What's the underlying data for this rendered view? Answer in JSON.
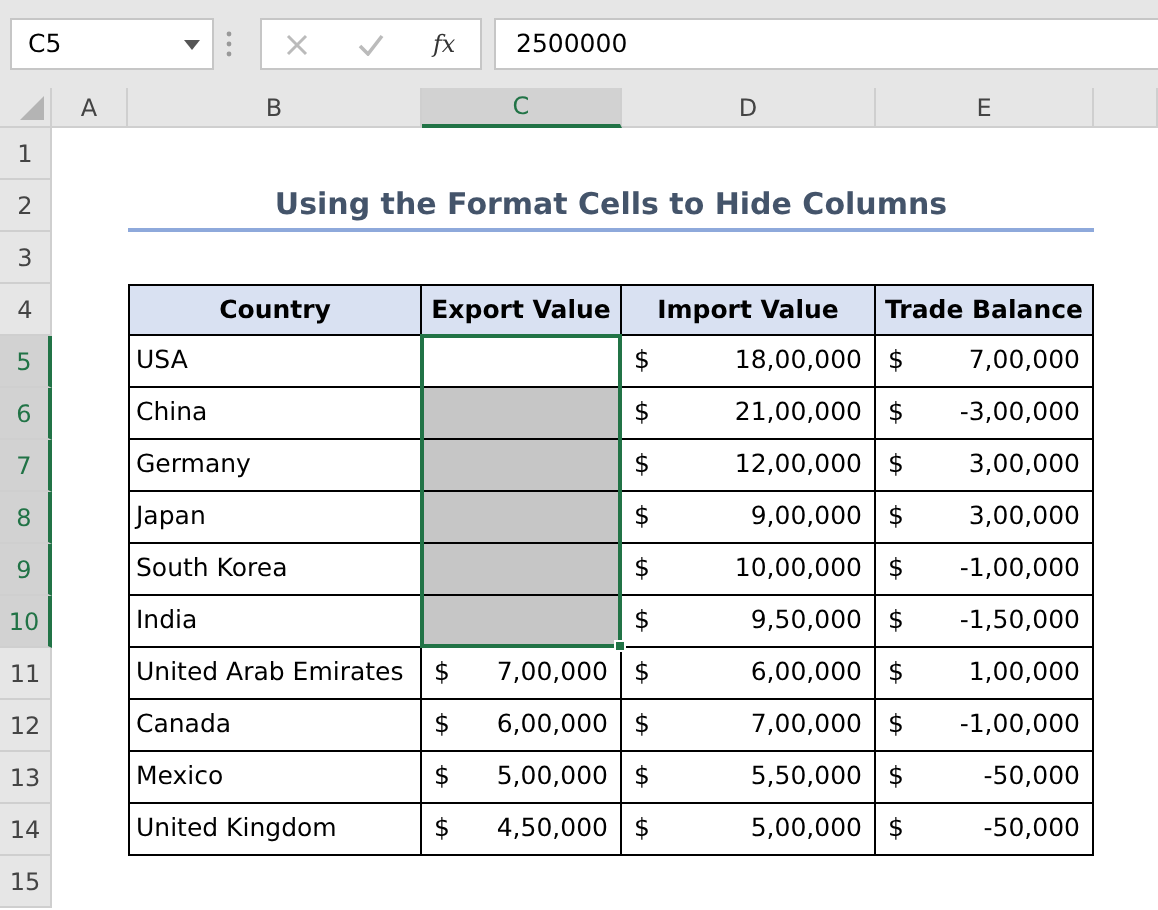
{
  "name_box": {
    "value": "C5"
  },
  "formula_bar": {
    "function_label": "fx",
    "value": "2500000",
    "cancel_disabled": true,
    "enter_disabled": true
  },
  "columns": [
    {
      "label": "A",
      "selected": false
    },
    {
      "label": "B",
      "selected": false
    },
    {
      "label": "C",
      "selected": true
    },
    {
      "label": "D",
      "selected": false
    },
    {
      "label": "E",
      "selected": false
    }
  ],
  "rows": [
    {
      "label": "1",
      "selected": false
    },
    {
      "label": "2",
      "selected": false
    },
    {
      "label": "3",
      "selected": false
    },
    {
      "label": "4",
      "selected": false
    },
    {
      "label": "5",
      "selected": true
    },
    {
      "label": "6",
      "selected": true
    },
    {
      "label": "7",
      "selected": true
    },
    {
      "label": "8",
      "selected": true
    },
    {
      "label": "9",
      "selected": true
    },
    {
      "label": "10",
      "selected": true
    },
    {
      "label": "11",
      "selected": false
    },
    {
      "label": "12",
      "selected": false
    },
    {
      "label": "13",
      "selected": false
    },
    {
      "label": "14",
      "selected": false
    },
    {
      "label": "15",
      "selected": false
    }
  ],
  "title": "Using the Format Cells to Hide Columns",
  "table": {
    "columns": [
      "Country",
      "Export Value",
      "Import Value",
      "Trade Balance"
    ],
    "rows": [
      {
        "country": "USA",
        "export": {
          "selected": true,
          "active": true
        },
        "import": {
          "currency": "$",
          "amount": "18,00,000"
        },
        "balance": {
          "currency": "$",
          "amount": "7,00,000"
        }
      },
      {
        "country": "China",
        "export": {
          "selected": true,
          "active": false
        },
        "import": {
          "currency": "$",
          "amount": "21,00,000"
        },
        "balance": {
          "currency": "$",
          "amount": "-3,00,000"
        }
      },
      {
        "country": "Germany",
        "export": {
          "selected": true,
          "active": false
        },
        "import": {
          "currency": "$",
          "amount": "12,00,000"
        },
        "balance": {
          "currency": "$",
          "amount": "3,00,000"
        }
      },
      {
        "country": "Japan",
        "export": {
          "selected": true,
          "active": false
        },
        "import": {
          "currency": "$",
          "amount": "9,00,000"
        },
        "balance": {
          "currency": "$",
          "amount": "3,00,000"
        }
      },
      {
        "country": "South Korea",
        "export": {
          "selected": true,
          "active": false
        },
        "import": {
          "currency": "$",
          "amount": "10,00,000"
        },
        "balance": {
          "currency": "$",
          "amount": "-1,00,000"
        }
      },
      {
        "country": "India",
        "export": {
          "selected": true,
          "active": false
        },
        "import": {
          "currency": "$",
          "amount": "9,50,000"
        },
        "balance": {
          "currency": "$",
          "amount": "-1,50,000"
        }
      },
      {
        "country": "United Arab Emirates",
        "export": {
          "currency": "$",
          "amount": "7,00,000",
          "selected": false
        },
        "import": {
          "currency": "$",
          "amount": "6,00,000"
        },
        "balance": {
          "currency": "$",
          "amount": "1,00,000"
        }
      },
      {
        "country": "Canada",
        "export": {
          "currency": "$",
          "amount": "6,00,000",
          "selected": false
        },
        "import": {
          "currency": "$",
          "amount": "7,00,000"
        },
        "balance": {
          "currency": "$",
          "amount": "-1,00,000"
        }
      },
      {
        "country": "Mexico",
        "export": {
          "currency": "$",
          "amount": "5,00,000",
          "selected": false
        },
        "import": {
          "currency": "$",
          "amount": "5,50,000"
        },
        "balance": {
          "currency": "$",
          "amount": "-50,000"
        }
      },
      {
        "country": "United Kingdom",
        "export": {
          "currency": "$",
          "amount": "4,50,000",
          "selected": false
        },
        "import": {
          "currency": "$",
          "amount": "5,00,000"
        },
        "balance": {
          "currency": "$",
          "amount": "-50,000"
        }
      }
    ]
  }
}
